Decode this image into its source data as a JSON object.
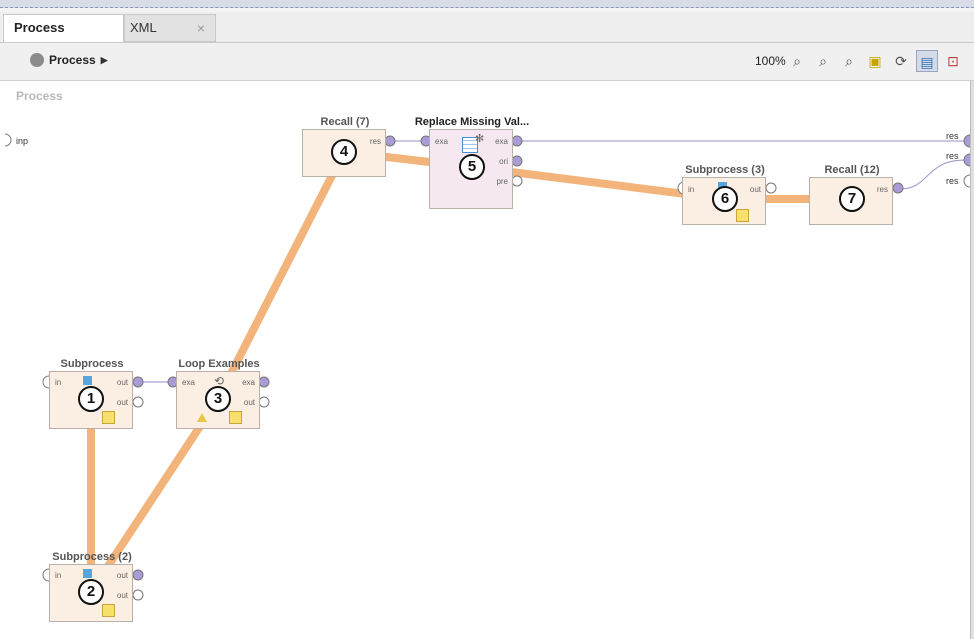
{
  "tabs": {
    "process": "Process",
    "xml": "XML",
    "close": "×"
  },
  "toolbar": {
    "breadcrumb": "Process",
    "zoom": "100%"
  },
  "canvas": {
    "title": "Process",
    "input_port": "inp",
    "output_ports": [
      "res",
      "res",
      "res"
    ]
  },
  "operators": {
    "subprocess1": {
      "title": "Subprocess",
      "badge": "1",
      "port_in": "in",
      "port_out1": "out",
      "port_out2": "out"
    },
    "subprocess2": {
      "title": "Subprocess (2)",
      "badge": "2",
      "port_in": "in",
      "port_out1": "out",
      "port_out2": "out"
    },
    "loop": {
      "title": "Loop Examples",
      "badge": "3",
      "port_in": "exa",
      "port_out1": "exa",
      "port_out2": "out"
    },
    "recall7": {
      "title": "Recall (7)",
      "badge": "4",
      "port_out": "res"
    },
    "replace": {
      "title": "Replace Missing Val...",
      "badge": "5",
      "port_in": "exa",
      "port_out1": "exa",
      "port_out2": "ori",
      "port_out3": "pre"
    },
    "subprocess3": {
      "title": "Subprocess (3)",
      "badge": "6",
      "port_in": "in",
      "port_out": "out"
    },
    "recall12": {
      "title": "Recall (12)",
      "badge": "7",
      "port_out": "res"
    }
  },
  "colors": {
    "execution_path": "#f3b47c",
    "wire": "#9a8fc7",
    "port": "#a99bd6"
  }
}
